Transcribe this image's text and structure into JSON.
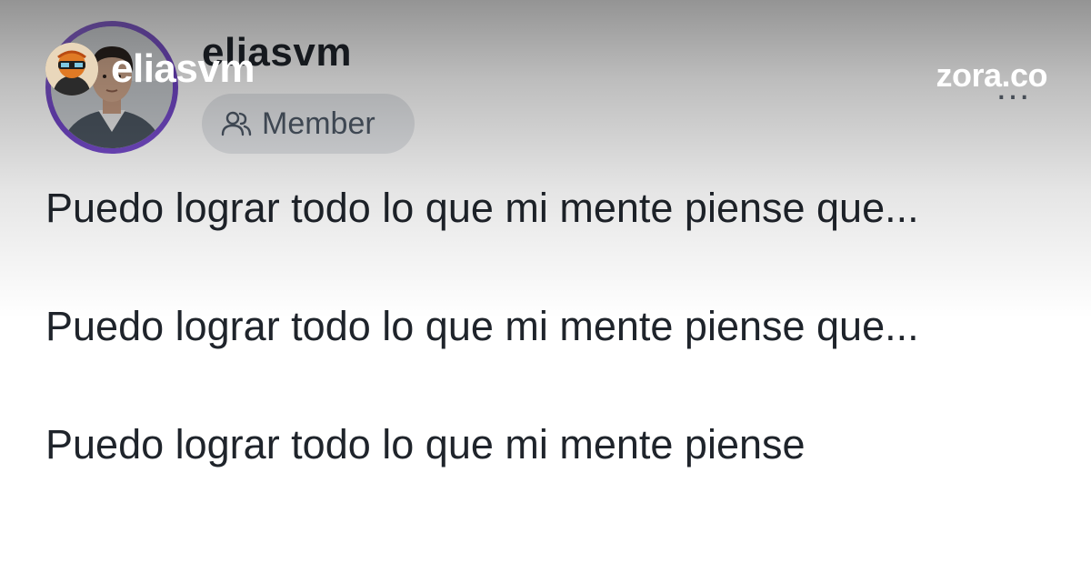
{
  "profile": {
    "username": "eliasvm",
    "badge_label": "Member",
    "badge_icon": "users-icon",
    "ring_color": "#7b4fd0"
  },
  "post": {
    "paragraphs": [
      "Puedo lograr todo lo que mi mente piense que...",
      "Puedo lograr todo lo que mi mente piense que...",
      "Puedo lograr todo lo que mi mente piense"
    ]
  },
  "overlay": {
    "creator_name": "eliasvm",
    "brand": "zora.co"
  },
  "menu": {
    "more_label": "…"
  }
}
